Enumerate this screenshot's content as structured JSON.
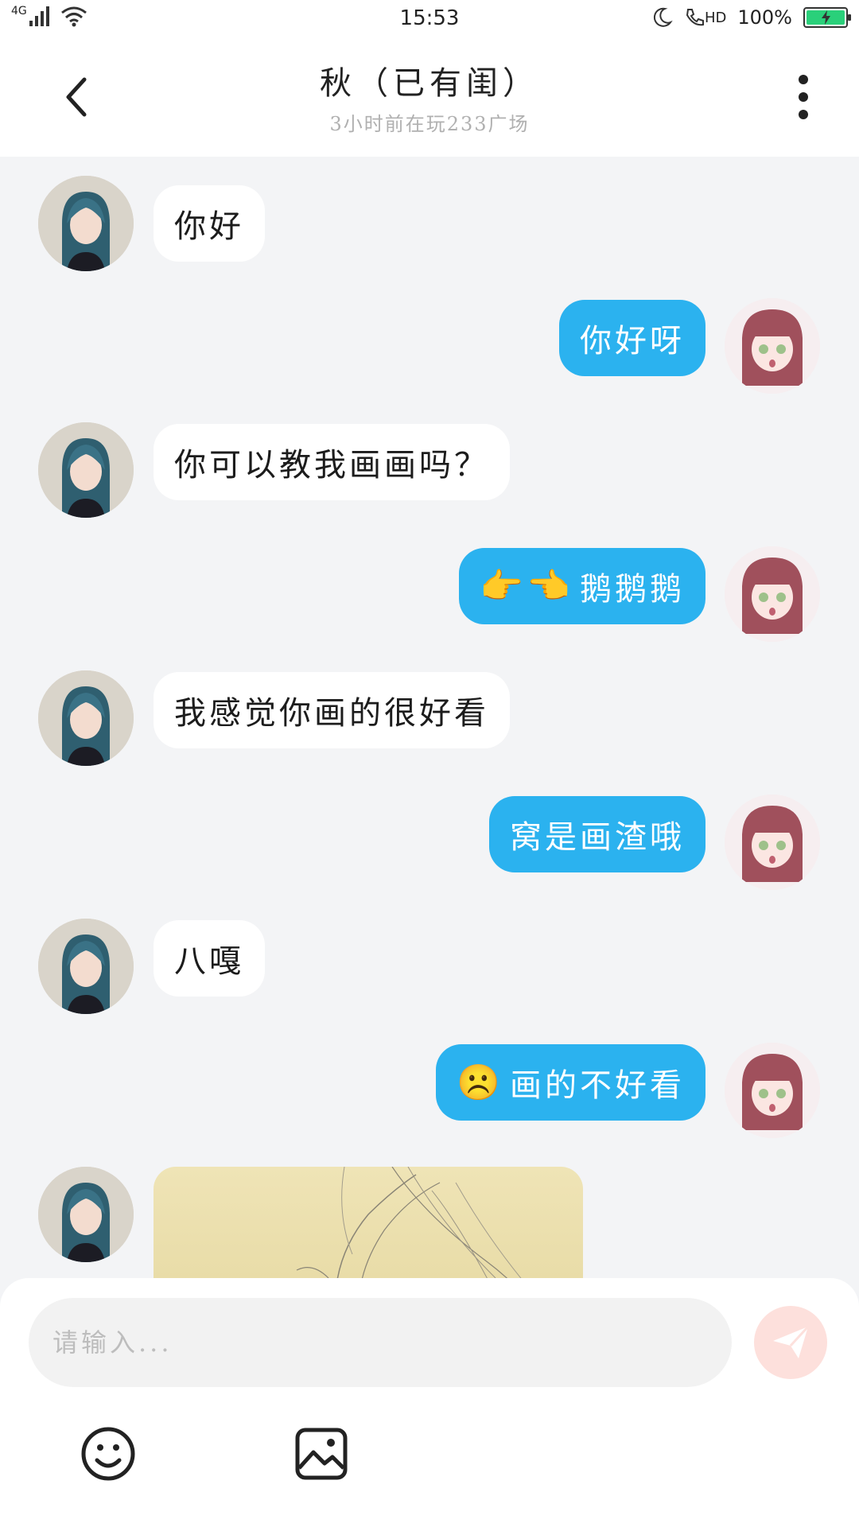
{
  "status_bar": {
    "network": "4G",
    "time": "15:53",
    "hd": "HD",
    "battery": "100%"
  },
  "header": {
    "title": "秋（已有闺）",
    "subtitle": "3小时前在玩233广场"
  },
  "messages": [
    {
      "from": "other",
      "text": "你好"
    },
    {
      "from": "me",
      "text": "你好呀"
    },
    {
      "from": "other",
      "text": "你可以教我画画吗？"
    },
    {
      "from": "me",
      "emoji": "👉👈",
      "text": "鹅鹅鹅"
    },
    {
      "from": "other",
      "text": "我感觉你画的很好看"
    },
    {
      "from": "me",
      "text": "窝是画渣哦"
    },
    {
      "from": "other",
      "text": "八嘎"
    },
    {
      "from": "me",
      "emoji": "☹️",
      "text": "画的不好看"
    }
  ],
  "input": {
    "placeholder": "请输入..."
  },
  "icons": {
    "back": "chevron-left-icon",
    "more": "more-vertical-icon",
    "send": "send-icon",
    "emoji": "emoji-icon",
    "image": "image-icon"
  },
  "colors": {
    "bubble_me": "#2bb2ef",
    "bubble_other": "#ffffff",
    "background": "#f3f4f6",
    "send_disabled": "#fde0dc"
  }
}
